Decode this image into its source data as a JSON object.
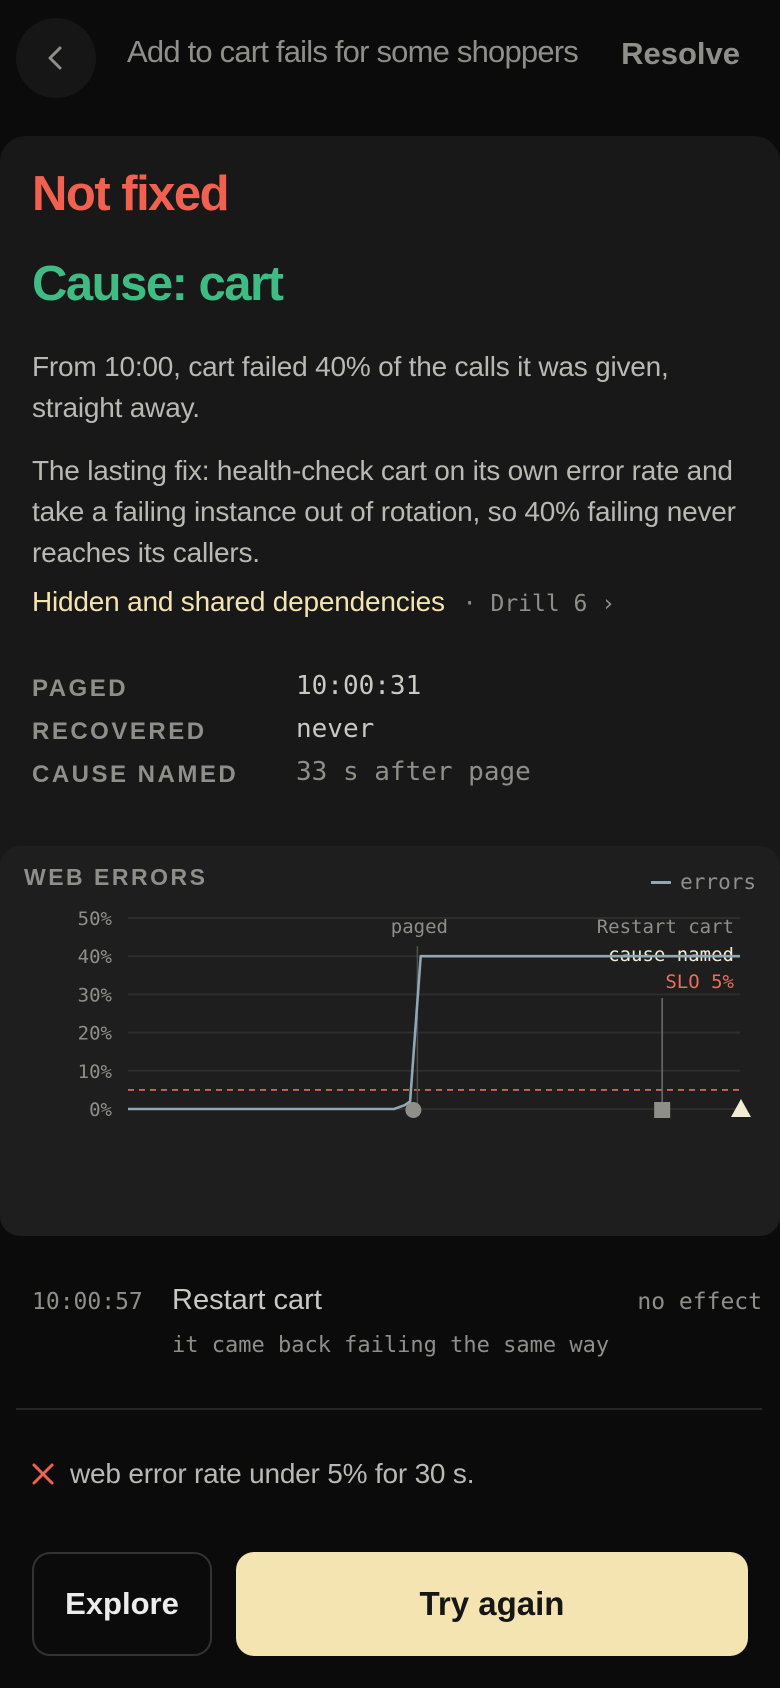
{
  "header": {
    "title": "Add to cart fails for some shoppers",
    "resolve_label": "Resolve"
  },
  "card": {
    "status": "Not fixed",
    "cause": "Cause: cart",
    "summary": "From 10:00, cart failed 40% of the calls it was given, straight away.",
    "fix": "The lasting fix: health-check cart on its own error rate and take a failing instance out of rotation, so 40% failing never reaches its callers.",
    "drill_title": "Hidden and shared dependencies",
    "drill_meta": "· Drill 6 ›",
    "stats": [
      {
        "label": "PAGED",
        "value": "10:00:31"
      },
      {
        "label": "RECOVERED",
        "value": "never"
      },
      {
        "label": "CAUSE NAMED",
        "value": "33 s after page"
      }
    ]
  },
  "chart_data": {
    "type": "line",
    "title": "WEB ERRORS",
    "legend": "errors",
    "legend_position": "top-right",
    "x_range_seconds": [
      0,
      115
    ],
    "ylim": [
      0,
      50
    ],
    "yticks": [
      "0%",
      "10%",
      "20%",
      "30%",
      "40%",
      "50%"
    ],
    "series": [
      {
        "name": "errors",
        "points": [
          [
            0,
            0
          ],
          [
            50,
            0
          ],
          [
            52,
            1
          ],
          [
            53,
            2
          ],
          [
            55,
            40
          ],
          [
            115,
            40
          ]
        ]
      }
    ],
    "slo": {
      "label": "SLO 5%",
      "value": 5
    },
    "events": [
      {
        "label": "paged",
        "x": 54,
        "marker": "circle"
      },
      {
        "label": "Restart cart",
        "x": 100,
        "marker": "square"
      },
      {
        "label": "cause named",
        "x": 115,
        "marker": "triangle"
      }
    ],
    "colors": {
      "line": "#8fa8b4",
      "slo": "#e8705c",
      "grid": "#2c2d2c",
      "tick": "#8f8f8a",
      "cause": "#f3ecd2",
      "marker": "#8f8f8a"
    },
    "grid": true
  },
  "action": {
    "time": "10:00:57",
    "name": "Restart cart",
    "result": "no effect",
    "detail": "it came back failing the same way"
  },
  "requirement": {
    "icon": "x-icon",
    "text": "web error rate under 5% for 30 s."
  },
  "buttons": {
    "explore": "Explore",
    "try_again": "Try again"
  },
  "colors": {
    "background": "#0b0b0b",
    "card": "#171817",
    "not_fixed": "#f2604f",
    "cause": "#3fbb84",
    "accent": "#f4e4b1"
  }
}
